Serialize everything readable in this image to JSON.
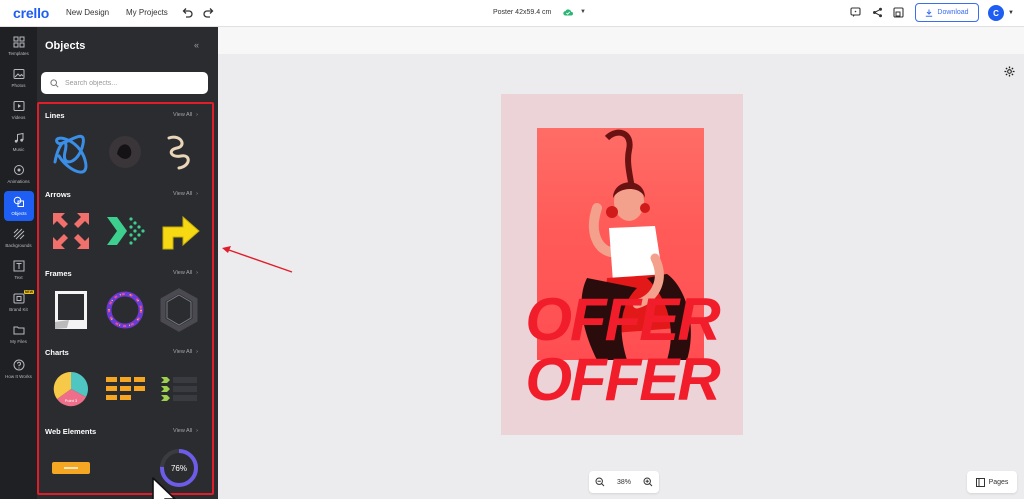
{
  "app": {
    "logo": "crello",
    "nav": [
      "New Design",
      "My Projects"
    ],
    "doc_title": "Poster 42x59.4 cm",
    "download_label": "Download",
    "avatar_letter": "C"
  },
  "rail": {
    "items": [
      {
        "label": "Templates",
        "icon": "templates-icon"
      },
      {
        "label": "Photos",
        "icon": "photos-icon"
      },
      {
        "label": "Videos",
        "icon": "videos-icon"
      },
      {
        "label": "Music",
        "icon": "music-icon"
      },
      {
        "label": "Animations",
        "icon": "animations-icon"
      },
      {
        "label": "Objects",
        "icon": "objects-icon",
        "active": true
      },
      {
        "label": "Backgrounds",
        "icon": "backgrounds-icon"
      },
      {
        "label": "Text",
        "icon": "text-icon"
      },
      {
        "label": "Brand Kit",
        "icon": "brand-kit-icon",
        "badge": "NEW"
      },
      {
        "label": "My Files",
        "icon": "folder-icon"
      },
      {
        "label": "How It Works",
        "icon": "help-icon"
      }
    ]
  },
  "panel": {
    "title": "Objects",
    "search_placeholder": "Search objects...",
    "view_all_label": "View All",
    "sections": [
      {
        "title": "Lines"
      },
      {
        "title": "Arrows"
      },
      {
        "title": "Frames"
      },
      {
        "title": "Charts"
      },
      {
        "title": "Web Elements"
      }
    ],
    "chart_thumb_label": "Point 3",
    "progress_ring_label": "76%",
    "progress_ring_value": 0.76
  },
  "canvas": {
    "offer_text": "OFFER",
    "zoom_level": "38%",
    "pages_label": "Pages"
  },
  "colors": {
    "brand": "#1e5ef3",
    "accent_red": "#f21d2b",
    "highlight": "#e11d2a"
  }
}
